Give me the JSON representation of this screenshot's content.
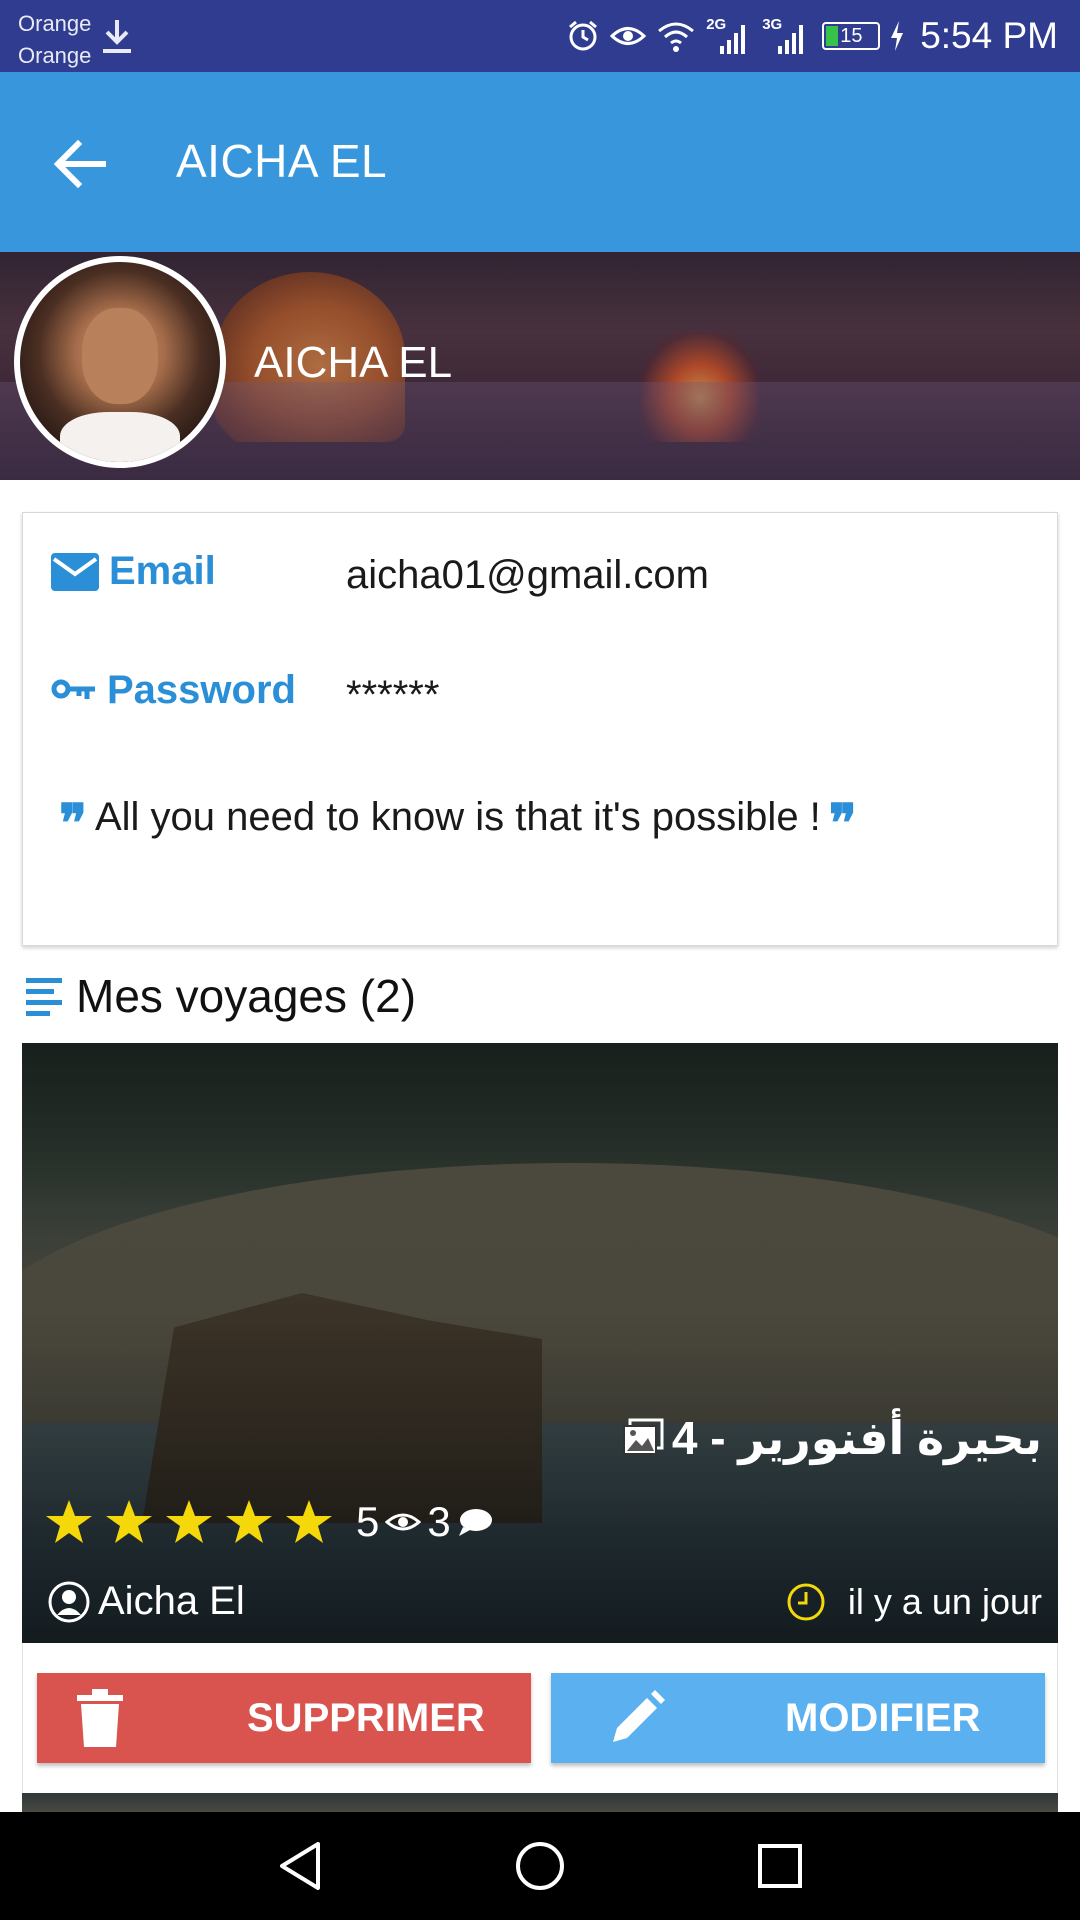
{
  "status_bar": {
    "carrier_1": "Orange",
    "carrier_2": "Orange",
    "network_2g": "2G",
    "network_3g": "3G",
    "battery": "15",
    "time": "5:54 PM"
  },
  "app_bar": {
    "title": "AICHA EL",
    "back_icon": "arrow-back-icon"
  },
  "profile": {
    "cover_name": "AICHA EL",
    "email_label": "Email",
    "email_value": "aicha01@gmail.com",
    "password_label": "Password",
    "password_value": "******",
    "quote": "All you need to know is that it's possible !"
  },
  "trips": {
    "section_title": "Mes voyages (2)",
    "items": [
      {
        "title": "بحيرة أفنورير - 4",
        "rating": "5",
        "views": "3",
        "author": "Aicha El",
        "time": "il y a un jour",
        "stars": 5
      }
    ]
  },
  "actions": {
    "delete_label": "SUPPRIMER",
    "edit_label": "MODIFIER"
  },
  "colors": {
    "status_bar": "#2f3c8f",
    "app_bar": "#3897dc",
    "accent": "#2a8fd6",
    "delete": "#d9534f",
    "edit": "#5bb0f0",
    "star": "#f5d80a"
  }
}
